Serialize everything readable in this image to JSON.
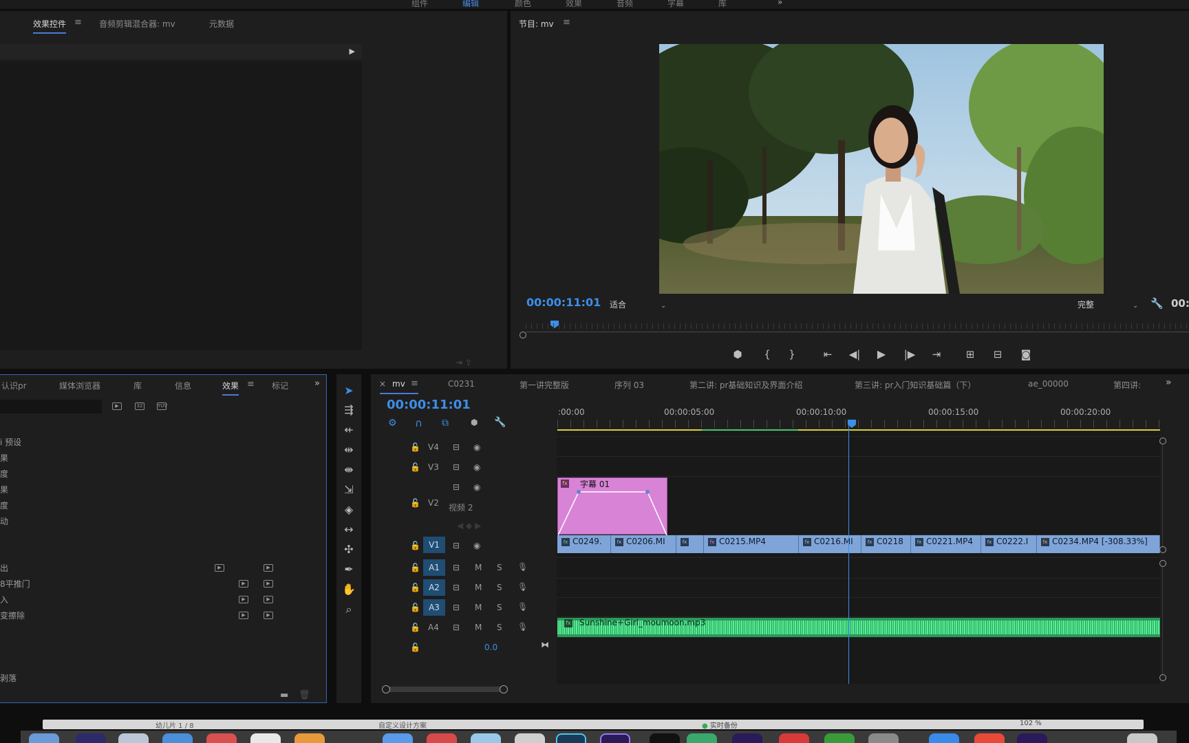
{
  "workspaces": [
    "组件",
    "编辑",
    "颜色",
    "效果",
    "音频",
    "字幕",
    "库"
  ],
  "source_panel": {
    "tabs": [
      "效果控件",
      "音频剪辑混合器: mv",
      "元数据"
    ],
    "active_tab": "效果控件"
  },
  "program_monitor": {
    "title": "节目: mv",
    "timecode": "00:00:11:01",
    "fit_value": "适合",
    "quality_value": "完整",
    "duration_partial": "00:"
  },
  "project_panel": {
    "tabs": [
      "认识pr",
      "媒体浏览器",
      "库",
      "信息",
      "效果",
      "标记"
    ],
    "active_tab": "效果",
    "items": [
      "i 预设",
      "果",
      "度",
      "果",
      "度",
      "动",
      "出",
      "8平推门",
      "入",
      "变擦除",
      "剥落"
    ]
  },
  "timeline": {
    "tabs": [
      "mv",
      "C0231",
      "第一讲完整版",
      "序列 03",
      "第二讲: pr基础知识及界面介绍",
      "第三讲: pr入门知识基础篇（下）",
      "ae_00000",
      "第四讲:"
    ],
    "active_tab": "mv",
    "timecode": "00:00:11:01",
    "ruler": [
      ":00:00",
      "00:00:05:00",
      "00:00:10:00",
      "00:00:15:00",
      "00:00:20:00"
    ],
    "tracks": {
      "v4": "V4",
      "v3": "V3",
      "v2": "V2",
      "v2_name": "视频 2",
      "v1": "V1",
      "a1": "A1",
      "a2": "A2",
      "a3": "A3",
      "a4": "A4",
      "mute": "M",
      "solo": "S",
      "master_volume": "0.0"
    },
    "title_clip": "字幕 01",
    "video_clips": [
      "C0249.",
      "C0206.MI",
      "",
      "C0215.MP4",
      "C0216.MI",
      "C0218",
      "C0221.MP4",
      "C0222.I",
      "C0234.MP4 [-308.33%]"
    ],
    "audio_clip": "Sunshine+Girl_moumoon.mp3"
  },
  "taskbar": {
    "left_text": "幼儿片 1 / 8",
    "center_text": "自定义设计方案",
    "backup_text": "实时备份",
    "zoom_text": "102 %"
  }
}
